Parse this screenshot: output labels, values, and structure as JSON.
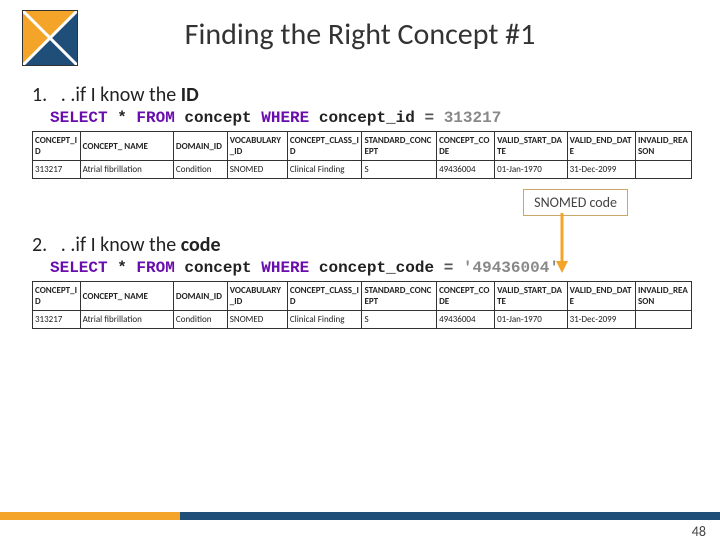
{
  "title": "Finding the Right Concept #1",
  "sections": [
    {
      "num": "1.",
      "prefix": ". .if I know the ",
      "bold": "ID",
      "sql_parts": {
        "kw1": "SELECT",
        "star": " * ",
        "kw2": "FROM",
        "t": " concept ",
        "kw3": "WHERE",
        "cond": " concept_id ",
        "eq": "=",
        "lit": " 313217"
      }
    },
    {
      "num": "2.",
      "prefix": ". .if I know the ",
      "bold": "code",
      "sql_parts": {
        "kw1": "SELECT",
        "star": " * ",
        "kw2": "FROM",
        "t": " concept ",
        "kw3": "WHERE",
        "cond": " concept_code ",
        "eq": "=",
        "lit": " '49436004'"
      }
    }
  ],
  "headers": [
    "CONCEPT_ID",
    "CONCEPT_ NAME",
    "DOMAIN_ID",
    "VOCABULARY _ID",
    "CONCEPT_CLASS_ID",
    "STANDARD_CONCEPT",
    "CONCEPT_CODE",
    "VALID_START_DATE",
    "VALID_END_DATE",
    "INVALID_REASON"
  ],
  "row": [
    "313217",
    "Atrial fibrillation",
    "Condition",
    "SNOMED",
    "Clinical Finding",
    "S",
    "49436004",
    "01-Jan-1970",
    "31-Dec-2099",
    ""
  ],
  "callout": "SNOMED code",
  "pagenum": "48"
}
